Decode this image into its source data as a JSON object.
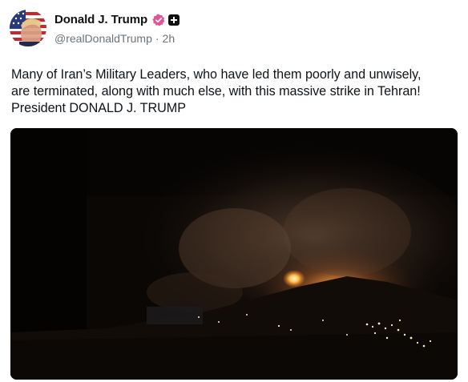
{
  "author": {
    "display_name": "Donald J. Trump",
    "handle": "@realDonaldTrump",
    "separator": "·",
    "time_ago": "2h",
    "verified_color": "#e2559c",
    "avatar_icon": "flag-portrait-avatar"
  },
  "post": {
    "lines": [
      "Many of Iran’s Military Leaders, who have led them poorly and unwisely,",
      "are terminated, along with much else, with this massive strike in Tehran!",
      "President DONALD J. TRUMP"
    ]
  },
  "media": {
    "icon": "night-explosion-image",
    "sky_color": "#0a0705",
    "glow_color": "#ffb84a"
  }
}
